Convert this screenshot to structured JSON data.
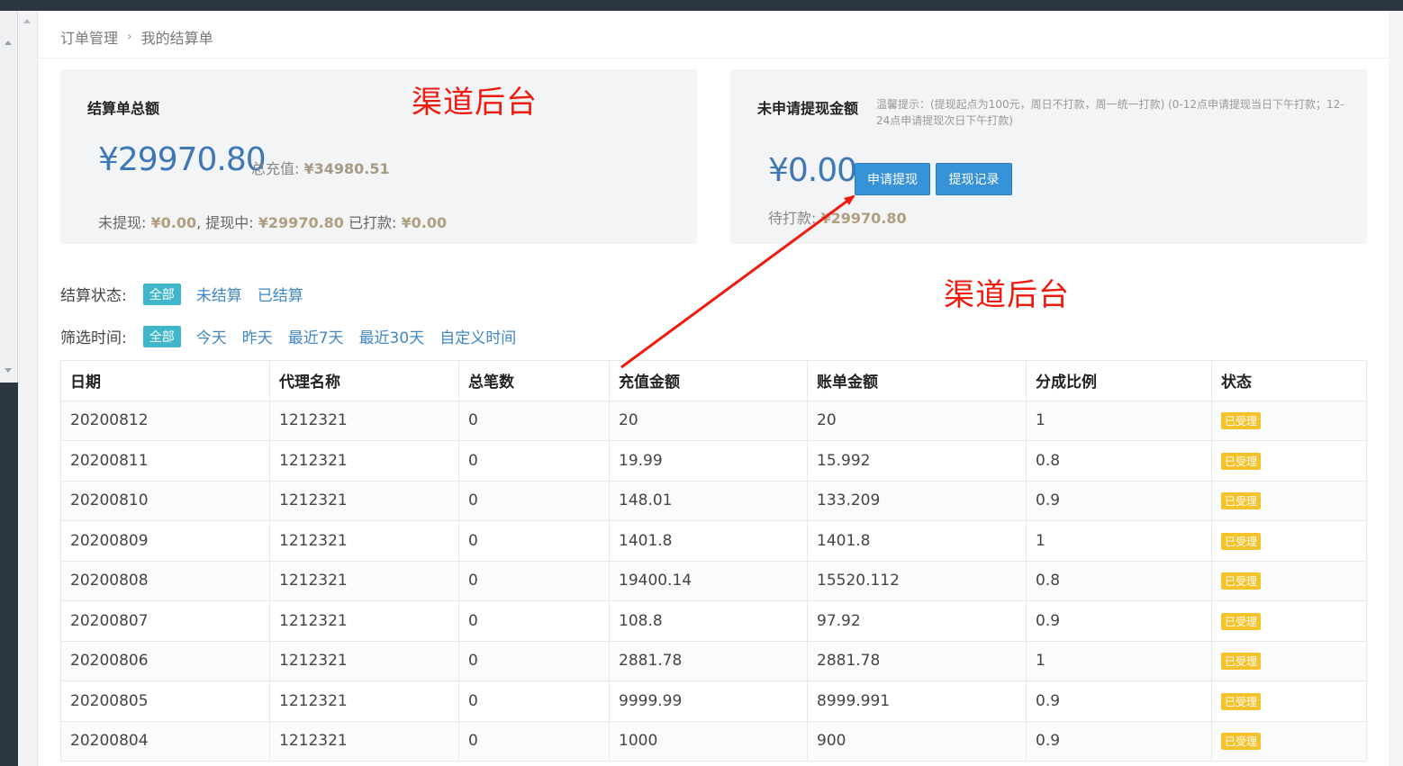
{
  "breadcrumb": {
    "parent": "订单管理",
    "separator": "›",
    "current": "我的结算单"
  },
  "watermark": {
    "text1": "渠道后台",
    "text2": "渠道后台"
  },
  "summary_card": {
    "title": "结算单总额",
    "amount": "¥29970.80",
    "total_recharge_label": "总充值:",
    "total_recharge_value": "¥34980.51",
    "unwithdrawn_label": "未提现:",
    "unwithdrawn_value": "¥0.00",
    "withdrawing_label": ", 提现中:",
    "withdrawing_value": "¥29970.80",
    "paid_label": "已打款:",
    "paid_value": "¥0.00"
  },
  "withdraw_card": {
    "title": "未申请提现金额",
    "tip": "温馨提示：(提现起点为100元，周日不打款，周一统一打款) (0-12点申请提现当日下午打款；12-24点申请提现次日下午打款)",
    "amount": "¥0.00",
    "apply_button": "申请提现",
    "record_button": "提现记录",
    "pending_label": "待打款:",
    "pending_value": "¥29970.80"
  },
  "status_filter": {
    "label": "结算状态:",
    "active": "全部",
    "options": [
      "未结算",
      "已结算"
    ]
  },
  "time_filter": {
    "label": "筛选时间:",
    "active": "全部",
    "options": [
      "今天",
      "昨天",
      "最近7天",
      "最近30天",
      "自定义时间"
    ]
  },
  "table": {
    "headers": [
      "日期",
      "代理名称",
      "总笔数",
      "充值金额",
      "账单金额",
      "分成比例",
      "状态"
    ],
    "rows": [
      [
        "20200812",
        "1212321",
        "0",
        "20",
        "20",
        "1",
        "已受理"
      ],
      [
        "20200811",
        "1212321",
        "0",
        "19.99",
        "15.992",
        "0.8",
        "已受理"
      ],
      [
        "20200810",
        "1212321",
        "0",
        "148.01",
        "133.209",
        "0.9",
        "已受理"
      ],
      [
        "20200809",
        "1212321",
        "0",
        "1401.8",
        "1401.8",
        "1",
        "已受理"
      ],
      [
        "20200808",
        "1212321",
        "0",
        "19400.14",
        "15520.112",
        "0.8",
        "已受理"
      ],
      [
        "20200807",
        "1212321",
        "0",
        "108.8",
        "97.92",
        "0.9",
        "已受理"
      ],
      [
        "20200806",
        "1212321",
        "0",
        "2881.78",
        "2881.78",
        "1",
        "已受理"
      ],
      [
        "20200805",
        "1212321",
        "0",
        "9999.99",
        "8999.991",
        "0.9",
        "已受理"
      ],
      [
        "20200804",
        "1212321",
        "0",
        "1000",
        "900",
        "0.9",
        "已受理"
      ]
    ]
  },
  "colors": {
    "accent": "#3793d8",
    "amount": "#3e78b5",
    "badge": "#f4c22b",
    "filter_active": "#3fb6c9",
    "annotation": "#f0190e"
  }
}
